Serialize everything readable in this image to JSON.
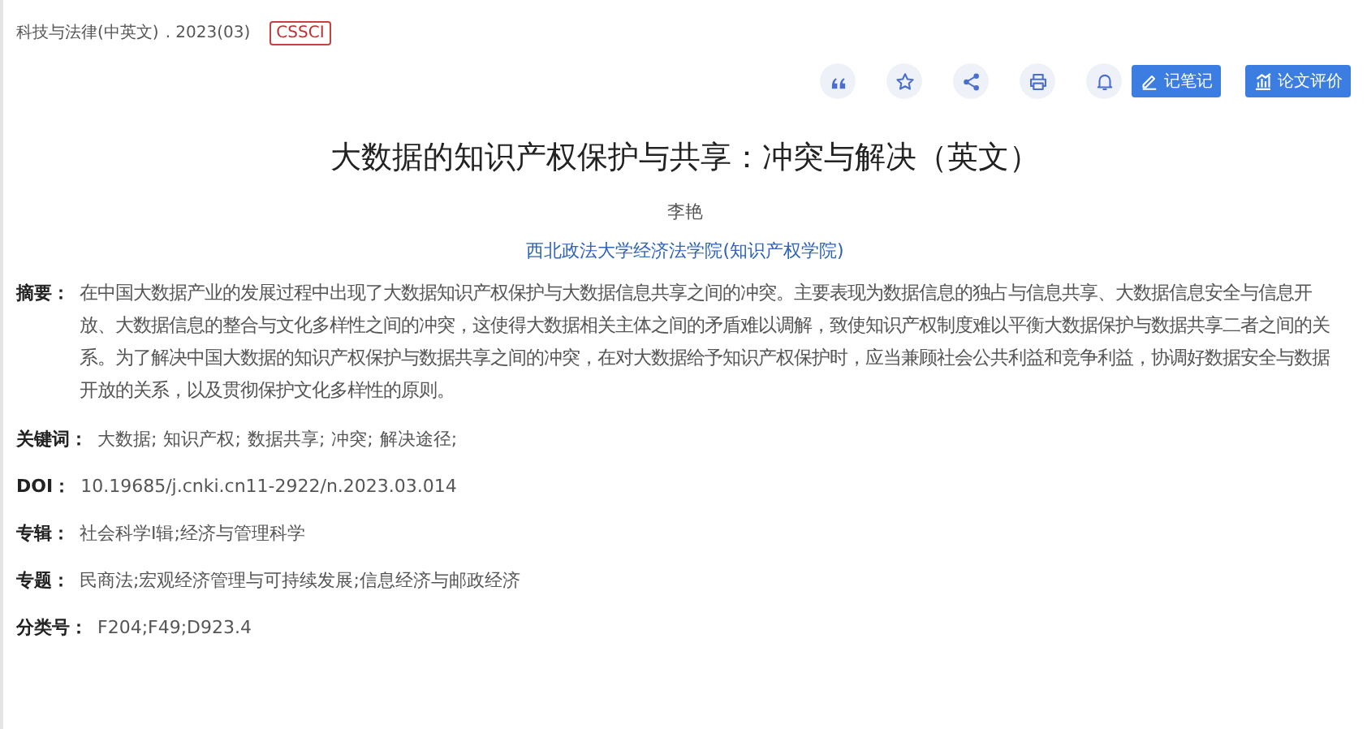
{
  "source": {
    "journal": "科技与法律(中英文)",
    "issue": ". 2023(03)",
    "badge": "CSSCI"
  },
  "toolbar": {
    "icons": [
      {
        "kind": "quote"
      },
      {
        "kind": "star"
      },
      {
        "kind": "share"
      },
      {
        "kind": "print"
      },
      {
        "kind": "bell"
      }
    ],
    "buttons": [
      {
        "kind": "note",
        "label": "记笔记"
      },
      {
        "kind": "chart",
        "label": "论文评价"
      }
    ]
  },
  "title": "大数据的知识产权保护与共享：冲突与解决（英文）",
  "author": "李艳",
  "affiliation": "西北政法大学经济法学院(知识产权学院)",
  "abstract": {
    "label": "摘要：",
    "text": "在中国大数据产业的发展过程中出现了大数据知识产权保护与大数据信息共享之间的冲突。主要表现为数据信息的独占与信息共享、大数据信息安全与信息开放、大数据信息的整合与文化多样性之间的冲突，这使得大数据相关主体之间的矛盾难以调解，致使知识产权制度难以平衡大数据保护与数据共享二者之间的关系。为了解决中国大数据的知识产权保护与数据共享之间的冲突，在对大数据给予知识产权保护时，应当兼顾社会公共利益和竞争利益，协调好数据安全与数据开放的关系，以及贯彻保护文化多样性的原则。"
  },
  "keywords": {
    "label": "关键词：",
    "items": [
      "大数据;",
      "知识产权;",
      "数据共享;",
      "冲突;",
      "解决途径;"
    ]
  },
  "fields": [
    {
      "label": "DOI：",
      "value": "10.19685/j.cnki.cn11-2922/n.2023.03.014"
    },
    {
      "label": "专辑：",
      "value": "社会科学Ⅰ辑;经济与管理科学"
    },
    {
      "label": "专题：",
      "value": "民商法;宏观经济管理与可持续发展;信息经济与邮政经济"
    },
    {
      "label": "分类号：",
      "value": "F204;F49;D923.4"
    }
  ]
}
